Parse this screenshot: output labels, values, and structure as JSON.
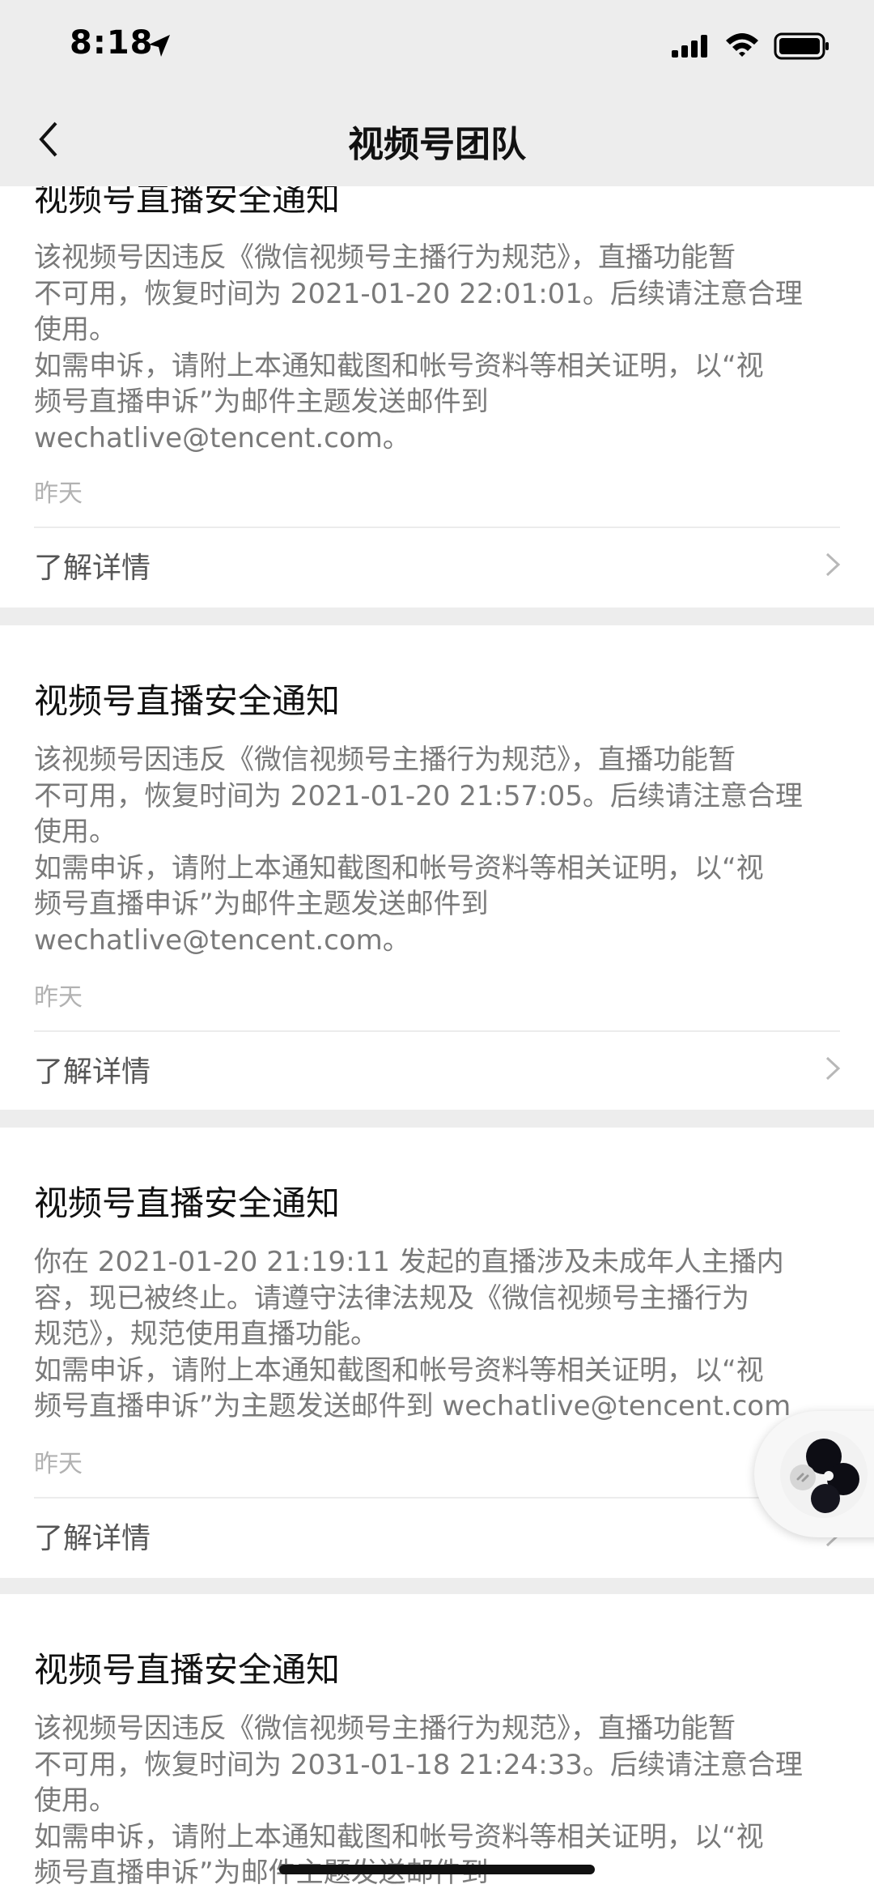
{
  "status_bar": {
    "time": "8:18"
  },
  "nav": {
    "title": "视频号团队"
  },
  "link_label": "了解详情",
  "cards": [
    {
      "title": "视频号直播安全通知",
      "body": [
        "该视频号因违反《微信视频号主播行为规范》，直播功能暂",
        "不可用，恢复时间为 2021-01-20 22:01:01。后续请注意合理",
        "使用。",
        "如需申诉，请附上本通知截图和帐号资料等相关证明，以“视",
        "频号直播申诉”为邮件主题发送邮件到",
        "wechatlive@tencent.com。"
      ],
      "time": "昨天"
    },
    {
      "title": "视频号直播安全通知",
      "body": [
        "该视频号因违反《微信视频号主播行为规范》，直播功能暂",
        "不可用，恢复时间为 2021-01-20 21:57:05。后续请注意合理",
        "使用。",
        "如需申诉，请附上本通知截图和帐号资料等相关证明，以“视",
        "频号直播申诉”为邮件主题发送邮件到",
        "wechatlive@tencent.com。"
      ],
      "time": "昨天"
    },
    {
      "title": "视频号直播安全通知",
      "body": [
        "你在 2021-01-20 21:19:11 发起的直播涉及未成年人主播内",
        "容，现已被终止。请遵守法律法规及《微信视频号主播行为",
        "规范》，规范使用直播功能。",
        "如需申诉，请附上本通知截图和帐号资料等相关证明，以“视",
        "频号直播申诉”为主题发送邮件到 wechatlive@tencent.com"
      ],
      "time": "昨天"
    },
    {
      "title": "视频号直播安全通知",
      "body": [
        "该视频号因违反《微信视频号主播行为规范》，直播功能暂",
        "不可用，恢复时间为 2031-01-18 21:24:33。后续请注意合理",
        "使用。",
        "如需申诉，请附上本通知截图和帐号资料等相关证明，以“视",
        "频号直播申诉”为邮件主题发送邮件到"
      ]
    }
  ],
  "colors": {
    "background": "#ededed",
    "card": "#ffffff",
    "title_text": "#111111",
    "body_text": "#7a7a7a",
    "time_text": "#b2b2b2"
  },
  "icons": [
    "location-arrow-icon",
    "signal-icon",
    "wifi-icon",
    "battery-icon",
    "back-chevron-icon",
    "chevron-right-icon",
    "link-icon"
  ]
}
